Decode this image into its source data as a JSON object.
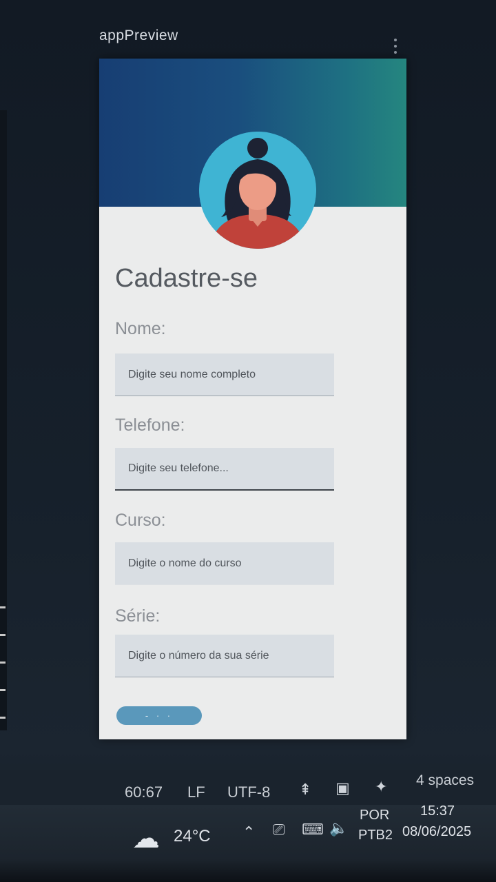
{
  "window": {
    "title": "appPreview"
  },
  "form": {
    "title": "Cadastre-se",
    "fields": [
      {
        "label": "Nome:",
        "placeholder": "Digite seu nome completo"
      },
      {
        "label": "Telefone:",
        "placeholder": "Digite seu telefone..."
      },
      {
        "label": "Curso:",
        "placeholder": "Digite o nome do curso"
      },
      {
        "label": "Série:",
        "placeholder": "Digite o número da sua série"
      }
    ],
    "submit_label": "- · ·"
  },
  "editor_status": {
    "cursor_position": "60:67",
    "line_ending": "LF",
    "encoding": "UTF-8",
    "indentation": "4 spaces",
    "icons": [
      "tree-icon",
      "feedback-icon",
      "sparkle-icon"
    ]
  },
  "taskbar": {
    "temperature": "24°C",
    "language": "POR",
    "keyboard": "PTB2",
    "time": "15:37",
    "date": "08/06/2025",
    "icons": [
      "cloud-weather-icon",
      "chevron-up-icon",
      "meet-now-icon",
      "network-icon",
      "volume-icon"
    ]
  },
  "colors": {
    "header_gradient_start": "#173e73",
    "header_gradient_end": "#25867f",
    "avatar_bg": "#3fb4d3",
    "button": "#5a98bb"
  }
}
